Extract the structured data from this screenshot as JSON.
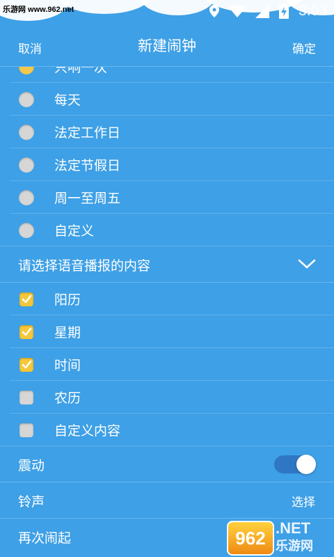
{
  "status_bar": {
    "watermark": "乐游网 www.962.net",
    "time": "3:03"
  },
  "header": {
    "cancel": "取消",
    "title": "新建闹钟",
    "confirm": "确定"
  },
  "repeat_options": [
    {
      "label": "只响一次",
      "selected": true
    },
    {
      "label": "每天",
      "selected": false
    },
    {
      "label": "法定工作日",
      "selected": false
    },
    {
      "label": "法定节假日",
      "selected": false
    },
    {
      "label": "周一至周五",
      "selected": false
    },
    {
      "label": "自定义",
      "selected": false
    }
  ],
  "broadcast": {
    "title": "请选择语音播报的内容",
    "items": [
      {
        "label": "阳历",
        "checked": true
      },
      {
        "label": "星期",
        "checked": true
      },
      {
        "label": "时间",
        "checked": true
      },
      {
        "label": "农历",
        "checked": false
      },
      {
        "label": "自定义内容",
        "checked": false
      }
    ]
  },
  "settings": {
    "vibrate_label": "震动",
    "vibrate_on": true,
    "ringtone_label": "铃声",
    "ringtone_value": "选择",
    "snooze_label": "再次闹起"
  },
  "watermark_bottom": {
    "badge": "962",
    "net": ".NET",
    "cn": "乐游网"
  },
  "colors": {
    "background": "#3ea0e6",
    "checkbox_on": "#f5c73a",
    "toggle_track": "#2f77c4"
  }
}
